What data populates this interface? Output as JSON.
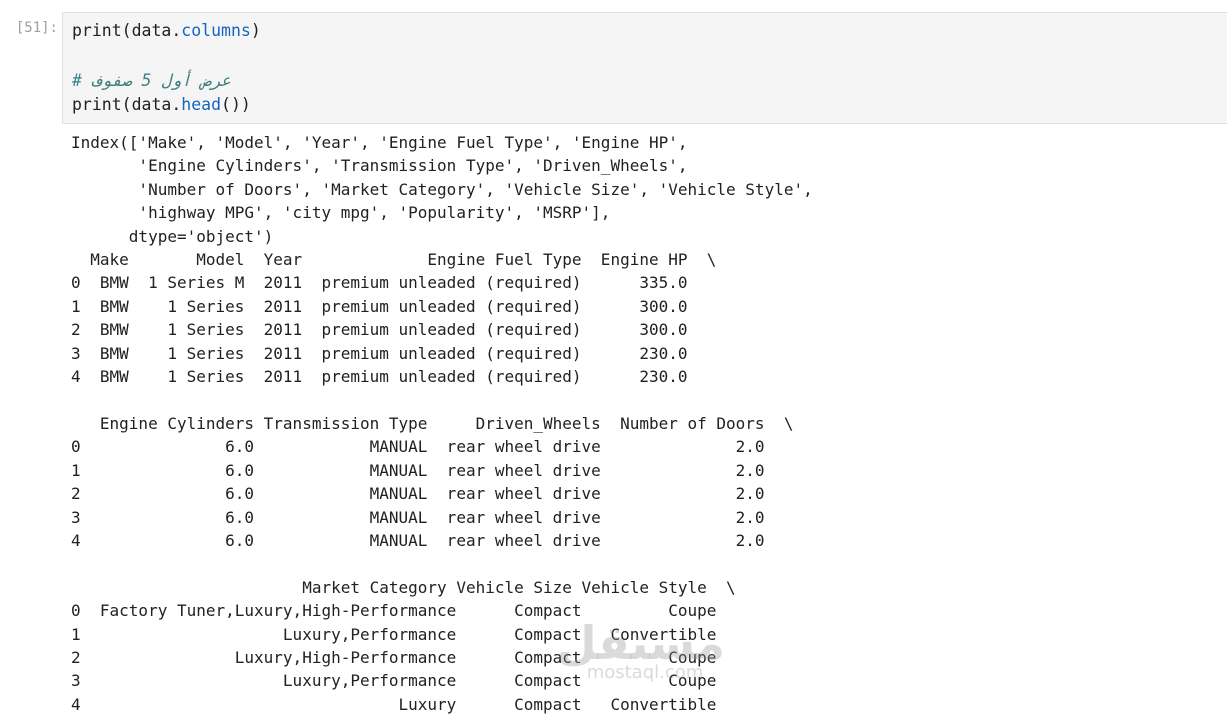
{
  "cell": {
    "prompt": "[51]:",
    "code": {
      "line1": {
        "kw": "print",
        "p1": "(data.",
        "attr": "columns",
        "p2": ")"
      },
      "comment": "# عرض أول 5 صفوف",
      "line3": {
        "kw": "print",
        "p1": "(data.",
        "attr": "head",
        "p2": "())"
      }
    },
    "output_lines": [
      "Index(['Make', 'Model', 'Year', 'Engine Fuel Type', 'Engine HP',",
      "       'Engine Cylinders', 'Transmission Type', 'Driven_Wheels',",
      "       'Number of Doors', 'Market Category', 'Vehicle Size', 'Vehicle Style',",
      "       'highway MPG', 'city mpg', 'Popularity', 'MSRP'],",
      "      dtype='object')",
      "  Make       Model  Year             Engine Fuel Type  Engine HP  \\",
      "0  BMW  1 Series M  2011  premium unleaded (required)      335.0",
      "1  BMW    1 Series  2011  premium unleaded (required)      300.0",
      "2  BMW    1 Series  2011  premium unleaded (required)      300.0",
      "3  BMW    1 Series  2011  premium unleaded (required)      230.0",
      "4  BMW    1 Series  2011  premium unleaded (required)      230.0",
      "",
      "   Engine Cylinders Transmission Type     Driven_Wheels  Number of Doors  \\",
      "0               6.0            MANUAL  rear wheel drive              2.0",
      "1               6.0            MANUAL  rear wheel drive              2.0",
      "2               6.0            MANUAL  rear wheel drive              2.0",
      "3               6.0            MANUAL  rear wheel drive              2.0",
      "4               6.0            MANUAL  rear wheel drive              2.0",
      "",
      "                        Market Category Vehicle Size Vehicle Style  \\",
      "0  Factory Tuner,Luxury,High-Performance      Compact         Coupe",
      "1                     Luxury,Performance      Compact   Convertible",
      "2                Luxury,High-Performance      Compact         Coupe",
      "3                     Luxury,Performance      Compact         Coupe",
      "4                                 Luxury      Compact   Convertible"
    ]
  },
  "watermark": {
    "arabic": "مستقل",
    "latin": "mostaql.com"
  }
}
